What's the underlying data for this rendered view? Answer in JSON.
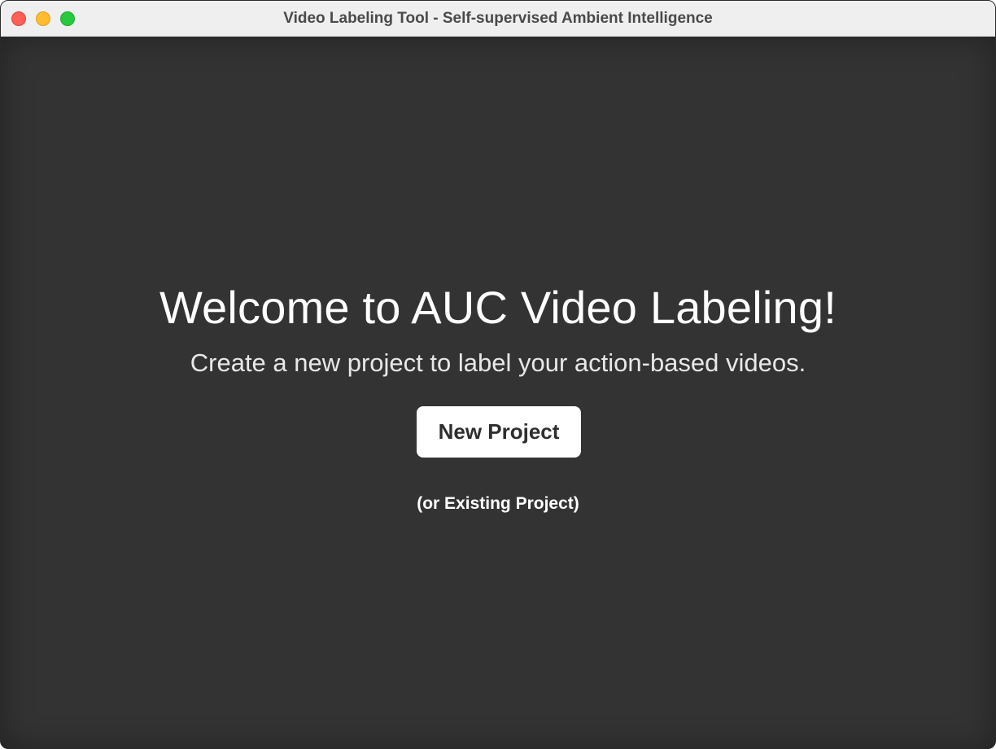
{
  "window": {
    "title": "Video Labeling Tool - Self-supervised Ambient Intelligence",
    "controls": {
      "close": "close-icon",
      "minimize": "minimize-icon",
      "zoom": "zoom-icon"
    }
  },
  "welcome": {
    "heading": "Welcome to AUC Video Labeling!",
    "subtitle": "Create a new project to label your action-based videos.",
    "new_project_label": "New Project",
    "existing_project_label": "(or Existing Project)"
  },
  "colors": {
    "background": "#333333",
    "titlebar": "#efefef",
    "button_bg": "#ffffff",
    "button_text": "#2e2e2e",
    "close": "#fe5f57",
    "minimize": "#febc2e",
    "zoom": "#28c840"
  }
}
